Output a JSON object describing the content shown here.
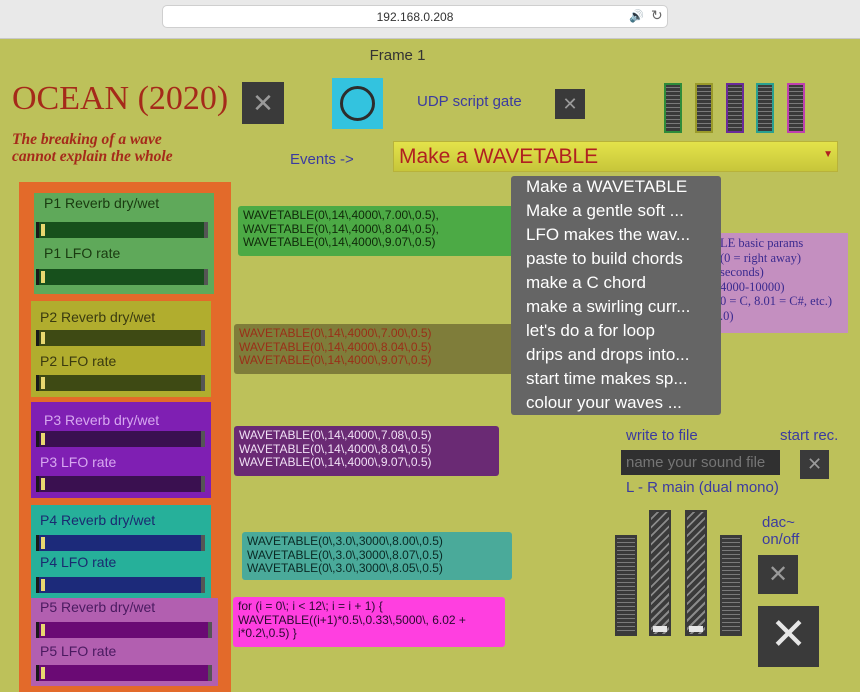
{
  "browser": {
    "url": "192.168.0.208",
    "speaker_icon": "speaker-icon",
    "reload_icon": "reload-icon"
  },
  "frame_title": "Frame 1",
  "header": {
    "title": "OCEAN (2020)",
    "tagline_line1": "The breaking of a wave",
    "tagline_line2": "cannot explain the whole",
    "close_glyph": "✕",
    "udp_label": "UDP script gate",
    "udp_close_glyph": "✕"
  },
  "meters": {
    "colors": [
      "#2e8b3a",
      "#9a9a2a",
      "#6a2a9a",
      "#2aa090",
      "#c040b0"
    ]
  },
  "events": {
    "label": "Events ->",
    "selected": "Make a WAVETABLE",
    "options": [
      "Make a WAVETABLE",
      "Make a gentle soft ...",
      "LFO makes the wav...",
      "paste to build chords",
      "make a C chord",
      "make a swirling curr...",
      "let's do a for loop",
      "drips and drops into...",
      "start time makes sp...",
      "colour your waves ..."
    ]
  },
  "info_box": {
    "lines": [
      "LE basic params",
      "(0 = right away)",
      "seconds)",
      "4000-10000)",
      "0 = C, 8.01 = C#, etc.)",
      ".0)"
    ]
  },
  "parts": [
    {
      "reverb_label": "P1 Reverb dry/wet",
      "lfo_label": "P1 LFO rate",
      "bg": "#5fa95a",
      "text_color": "#1a3a10",
      "track": "#17501c",
      "code_bg": "#4caa45",
      "code_color": "#102a0a",
      "code": [
        "WAVETABLE(0\\,14\\,4000\\,7.00\\,0.5),",
        "WAVETABLE(0\\,14\\,4000\\,8.04\\,0.5),",
        "WAVETABLE(0\\,14\\,4000\\,9.07\\,0.5)"
      ]
    },
    {
      "reverb_label": "P2 Reverb dry/wet",
      "lfo_label": "P2 LFO rate",
      "bg": "#b1ad2e",
      "text_color": "#3a3a10",
      "track": "#3e4a14",
      "code_bg": "#7f7d3a",
      "code_color": "#9a2f18",
      "code": [
        "WAVETABLE(0\\,14\\,4000\\,7.00\\,0.5)",
        "WAVETABLE(0\\,14\\,4000\\,8.04\\,0.5)",
        "WAVETABLE(0\\,14\\,4000\\,9.07\\,0.5)"
      ]
    },
    {
      "reverb_label": "P3 Reverb dry/wet",
      "lfo_label": "P3 LFO rate",
      "bg": "#7f1fb3",
      "text_color": "#d7a8f0",
      "track": "#3a1050",
      "code_bg": "#6a2a74",
      "code_color": "#f0e0f5",
      "code": [
        "WAVETABLE(0\\,14\\,4000\\,7.08\\,0.5)",
        "WAVETABLE(0\\,14\\,4000\\,8.04\\,0.5)",
        "WAVETABLE(0\\,14\\,4000\\,9.07\\,0.5)"
      ]
    },
    {
      "reverb_label": "P4 Reverb dry/wet",
      "lfo_label": "P4 LFO rate",
      "bg": "#26b09a",
      "text_color": "#1a2a70",
      "track": "#1c2a7a",
      "code_bg": "#4aaa9a",
      "code_color": "#0a2a25",
      "code": [
        "WAVETABLE(0\\,3.0\\,3000\\,8.00\\,0.5)",
        "WAVETABLE(0\\,3.0\\,3000\\,8.07\\,0.5)",
        "WAVETABLE(0\\,3.0\\,3000\\,8.05\\,0.5)"
      ]
    },
    {
      "reverb_label": "P5 Reverb dry/wet",
      "lfo_label": "P5 LFO rate",
      "bg": "#b25fb0",
      "text_color": "#4a1a60",
      "track": "#6a0a74",
      "code_bg": "#ff3fe0",
      "code_color": "#2a0a30",
      "code": [
        "for (i = 0\\; i < 12\\; i = i + 1) {",
        "WAVETABLE((i+1)*0.5\\,0.33\\,5000\\, 6.02 +",
        "i*0.2\\,0.5) }"
      ]
    }
  ],
  "recording": {
    "write_label": "write to file",
    "start_label": "start rec.",
    "file_placeholder": "name your sound file",
    "rec_close_glyph": "✕",
    "output_label": "L - R main (dual mono)",
    "dac_line1": "dac~",
    "dac_line2": "on/off",
    "dac_glyph": "✕",
    "big_glyph": "✕"
  }
}
